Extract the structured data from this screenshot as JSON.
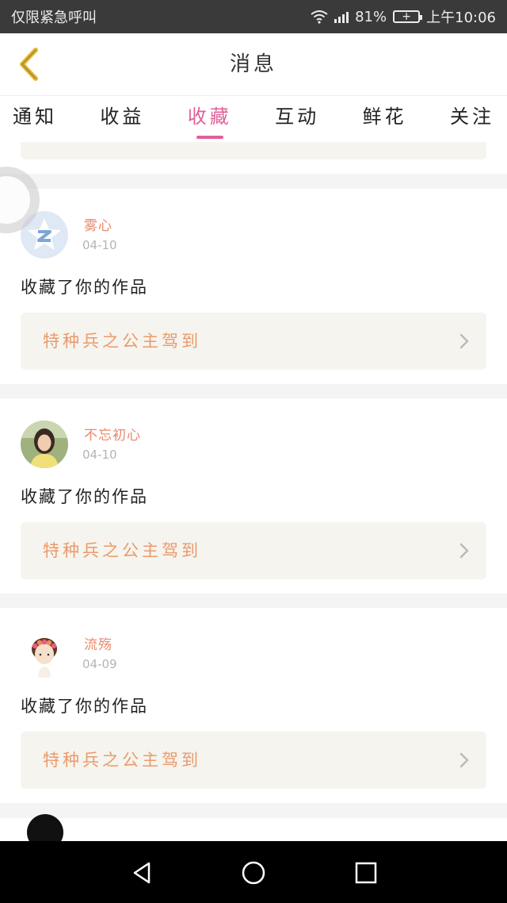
{
  "status_bar": {
    "left_text": "仅限紧急呼叫",
    "battery_percent": "81%",
    "time": "上午10:06",
    "icons": [
      "wifi-icon",
      "signal-icon",
      "battery-icon"
    ]
  },
  "header": {
    "title": "消息",
    "back_icon": "chevron-left-icon",
    "back_color": "#e5b531"
  },
  "tabs": {
    "items": [
      {
        "label": "通知"
      },
      {
        "label": "收益"
      },
      {
        "label": "收藏",
        "active": true
      },
      {
        "label": "互动"
      },
      {
        "label": "鲜花"
      },
      {
        "label": "关注"
      }
    ],
    "active_color": "#e0609a"
  },
  "messages": [
    {
      "user": "雾心",
      "date": "04-10",
      "action": "收藏了你的作品",
      "work_title": "特种兵之公主驾到",
      "avatar": "qq-default-avatar-icon"
    },
    {
      "user": "不忘初心",
      "date": "04-10",
      "action": "收藏了你的作品",
      "work_title": "特种兵之公主驾到",
      "avatar": "user-photo-avatar"
    },
    {
      "user": "流殇",
      "date": "04-09",
      "action": "收藏了你的作品",
      "work_title": "特种兵之公主驾到",
      "avatar": "cartoon-girl-avatar"
    }
  ],
  "colors": {
    "username": "#e8896d",
    "work_title": "#eb9a6c",
    "card_bg": "#f5f4ee"
  },
  "nav": {
    "icons": [
      "back-triangle-icon",
      "home-circle-icon",
      "recents-square-icon"
    ]
  }
}
